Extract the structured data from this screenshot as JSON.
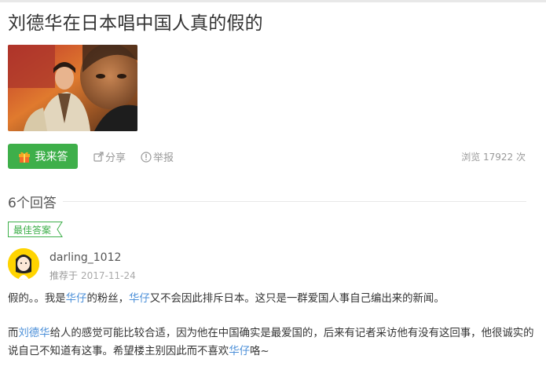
{
  "question": {
    "title": "刘德华在日本唱中国人真的假的"
  },
  "actions": {
    "answer_label": "我来答",
    "share_label": "分享",
    "report_label": "举报",
    "views_text": "浏览 17922 次"
  },
  "answers": {
    "count_text": "6个回答"
  },
  "best_answer": {
    "tag_label": "最佳答案",
    "username": "darling_1012",
    "recommend_label": "推荐于",
    "date": "2017-11-24",
    "p1": [
      {
        "t": "假的。。我是",
        "link": false
      },
      {
        "t": "华仔",
        "link": true
      },
      {
        "t": "的粉丝，",
        "link": false
      },
      {
        "t": "华仔",
        "link": true
      },
      {
        "t": "又不会因此排斥日本。这只是一群爱国人事自己编出来的新闻。",
        "link": false
      }
    ],
    "p2": [
      {
        "t": "而",
        "link": false
      },
      {
        "t": "刘德华",
        "link": true
      },
      {
        "t": "给人的感觉可能比较合适，因为他在中国确实是最爱国的，后来有记者采访他有没有这回事，他很诚实的说自己不知道有这事。希望楼主别因此而不喜欢",
        "link": false
      },
      {
        "t": "华仔",
        "link": true
      },
      {
        "t": "咯~",
        "link": false
      }
    ]
  },
  "colors": {
    "accent_green": "#3eaf4a",
    "link_blue": "#4b8fd8",
    "muted_gray": "#999999"
  },
  "icons": [
    "gift-icon",
    "share-icon",
    "report-icon"
  ]
}
